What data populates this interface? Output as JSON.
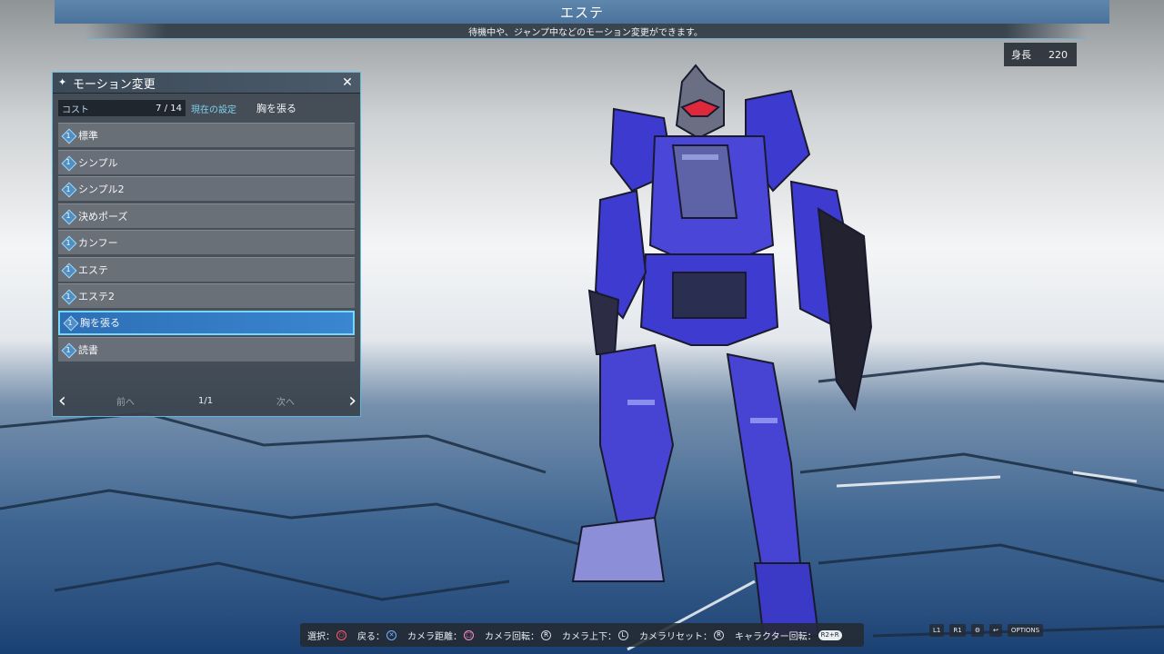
{
  "header": {
    "title": "エステ",
    "subtitle": "待機中や、ジャンプ中などのモーション変更ができます。"
  },
  "height_badge": {
    "label": "身長",
    "value": "220"
  },
  "panel": {
    "title": "モーション変更",
    "cost_label": "コスト",
    "cost_value": "7 / 14",
    "current_label": "現在の設定",
    "current_value": "胸を張る",
    "items": [
      {
        "level": "1",
        "label": "標準"
      },
      {
        "level": "1",
        "label": "シンプル"
      },
      {
        "level": "1",
        "label": "シンプル2"
      },
      {
        "level": "1",
        "label": "決めポーズ"
      },
      {
        "level": "1",
        "label": "カンフー"
      },
      {
        "level": "1",
        "label": "エステ"
      },
      {
        "level": "1",
        "label": "エステ2"
      },
      {
        "level": "1",
        "label": "胸を張る"
      },
      {
        "level": "1",
        "label": "読書"
      }
    ],
    "selected_index": 7,
    "pager": {
      "prev": "前へ",
      "page": "1/1",
      "next": "次へ"
    }
  },
  "controls": [
    {
      "label": "選択：",
      "button": "○"
    },
    {
      "label": "戻る：",
      "button": "✕"
    },
    {
      "label": "カメラ距離：",
      "button": "□"
    },
    {
      "label": "カメラ回転：",
      "button": "R"
    },
    {
      "label": "カメラ上下：",
      "button": "L"
    },
    {
      "label": "カメラリセット：",
      "button": "R"
    },
    {
      "label": "キャラクター回転：",
      "button": "R2+R"
    }
  ],
  "right_icons": [
    "L1",
    "R1",
    "⚙",
    "↩",
    "OPTIONS"
  ],
  "colors": {
    "accent": "#5fb7dd",
    "selected": "#3a86d0",
    "mech_blue": "#3e3bd0"
  }
}
